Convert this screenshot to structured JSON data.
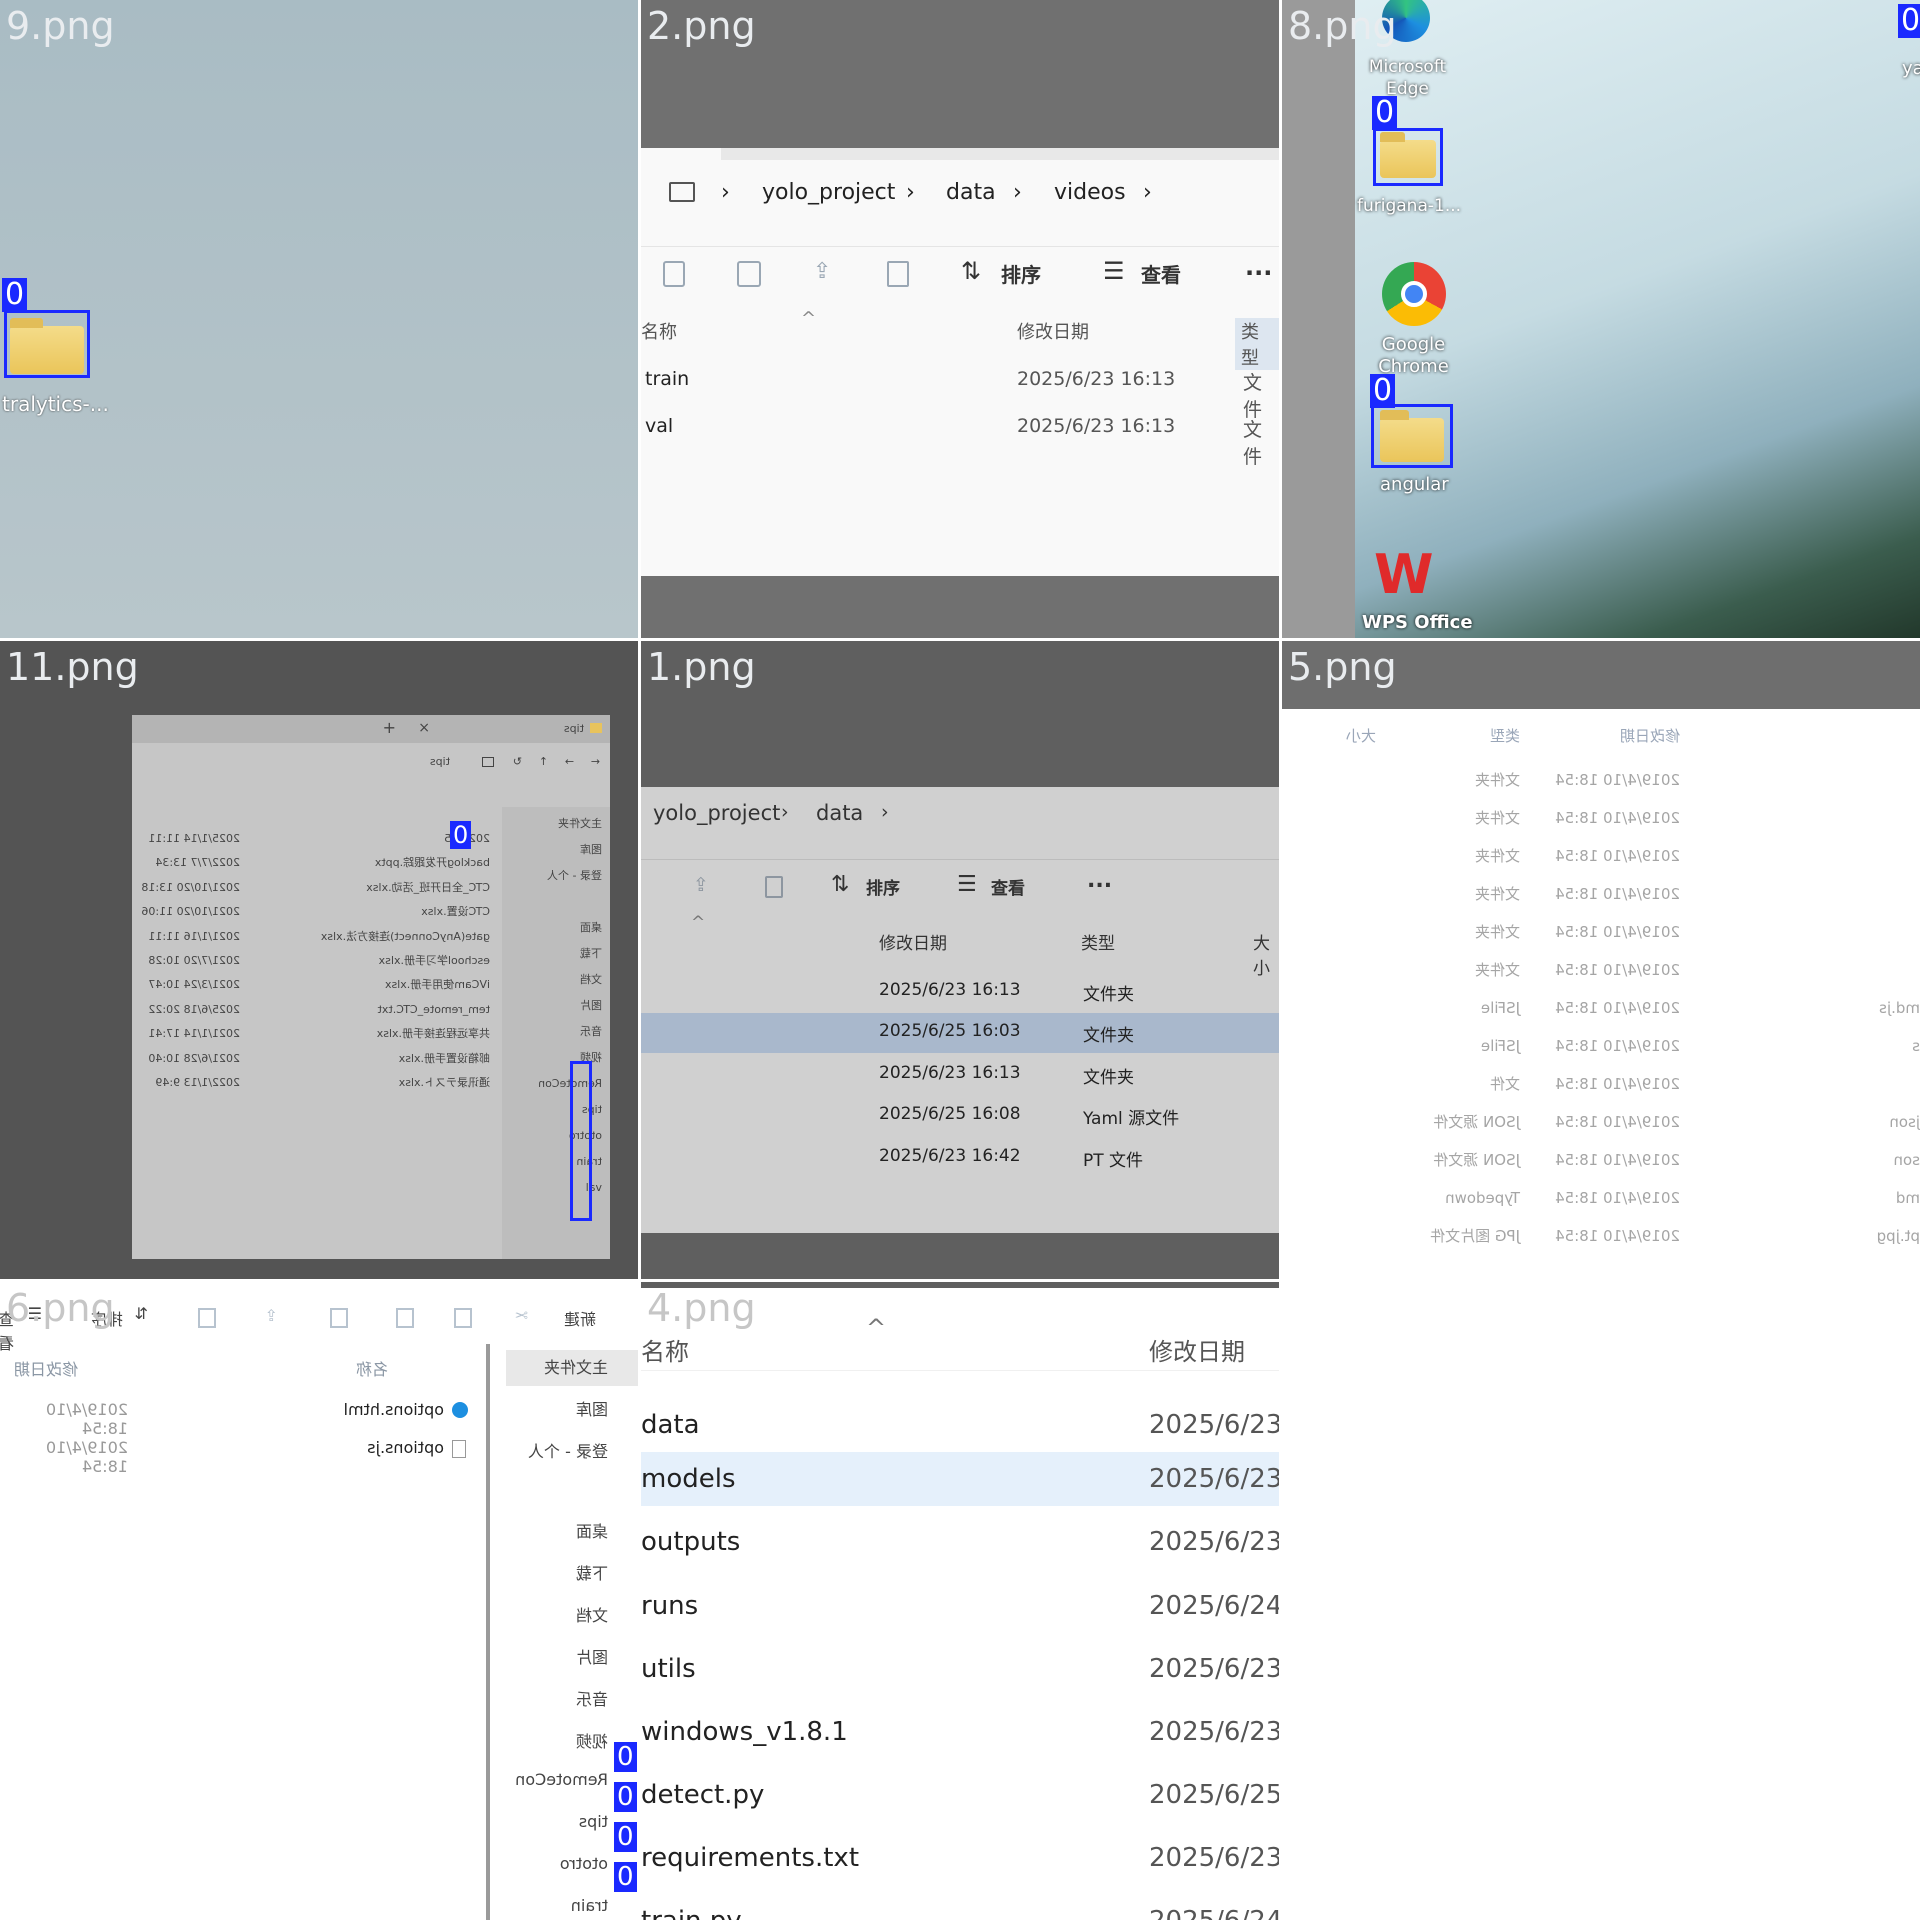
{
  "tiles": {
    "t9": {
      "label": "9.png",
      "folder_name": "tralytics-..."
    },
    "t2": {
      "label": "2.png",
      "breadcrumb": [
        "yolo_project",
        "data",
        "videos"
      ],
      "toolbar": {
        "sort": "排序",
        "view": "查看",
        "more": "..."
      },
      "columns": {
        "name": "名称",
        "modified": "修改日期",
        "type": "类型"
      },
      "rows": [
        {
          "name": "train",
          "modified": "2025/6/23 16:13",
          "type": "文件"
        },
        {
          "name": "val",
          "modified": "2025/6/23 16:13",
          "type": "文件"
        }
      ]
    },
    "t8": {
      "label": "8.png",
      "icons": {
        "edge": "Microsoft Edge",
        "furigana": "furigana-1...",
        "chrome": "Google Chrome",
        "angular": "angular",
        "wps": "WPS Office"
      },
      "right_edge_text": "ya",
      "tag": "0"
    },
    "t11": {
      "label": "11.png",
      "title": "tips",
      "rows": [
        {
          "name": "2022-05",
          "date": "2025/1/14 11:11"
        },
        {
          "name": "backlog开发跟踪.pptx",
          "date": "2022/7/7 13:34"
        },
        {
          "name": "CTC_全日开班_活动.xlsx",
          "date": "2021/10/20 13:18"
        },
        {
          "name": "CTC设置.xlsx",
          "date": "2021/10/20 11:06"
        },
        {
          "name": "gate(AnyConnect)连接方法.xlsx",
          "date": "2021/1/16 11:11"
        },
        {
          "name": "eschool学习手册.xlsx",
          "date": "2021/7/20 10:28"
        },
        {
          "name": "iVCam使用手册.xlsx",
          "date": "2021/3/24 10:47"
        },
        {
          "name": "tem_remote_CTC.txt",
          "date": "2025/6/18 20:22"
        },
        {
          "name": "共享远程连接手册.xlsx",
          "date": "2021/1/14 17:41"
        },
        {
          "name": "邮箱设置手册.xlsx",
          "date": "2021/6/28 10:40"
        },
        {
          "name": "通讯录テスト.xlsx",
          "date": "2022/1/13 9:49"
        }
      ],
      "sidebar": [
        "主文件夹",
        "图库",
        "登录 - 个人",
        "桌面",
        "下载",
        "文档",
        "图片",
        "音乐",
        "视频",
        "RemoteCon",
        "tips",
        "ototro",
        "train",
        "val"
      ]
    },
    "t1": {
      "label": "1.png",
      "breadcrumb": [
        "yolo_project",
        "data"
      ],
      "toolbar": {
        "sort": "排序",
        "view": "查看",
        "more": "..."
      },
      "columns": {
        "modified": "修改日期",
        "type": "类型",
        "size": "大小"
      },
      "rows": [
        {
          "modified": "2025/6/23 16:13",
          "type": "文件夹"
        },
        {
          "modified": "2025/6/25 16:03",
          "type": "文件夹"
        },
        {
          "modified": "2025/6/23 16:13",
          "type": "文件夹"
        },
        {
          "modified": "2025/6/25 16:08",
          "type": "Yaml 源文件"
        },
        {
          "modified": "2025/6/23 16:42",
          "type": "PT 文件"
        }
      ]
    },
    "t5": {
      "label": "5.png",
      "columns": {
        "size": "大小",
        "type": "类型",
        "modified": "修改日期"
      },
      "rows": [
        {
          "modified": "2019/4/10 18:54",
          "type": "文件夹",
          "name": ""
        },
        {
          "modified": "2019/4/10 18:54",
          "type": "文件夹",
          "name": ""
        },
        {
          "modified": "2019/4/10 18:54",
          "type": "文件夹",
          "name": ""
        },
        {
          "modified": "2019/4/10 18:54",
          "type": "文件夹",
          "name": ""
        },
        {
          "modified": "2019/4/10 18:54",
          "type": "文件夹",
          "name": ""
        },
        {
          "modified": "2019/4/10 18:54",
          "type": "文件夹",
          "name": ""
        },
        {
          "modified": "2019/4/10 18:54",
          "type": "JSFile",
          "name": "md.js"
        },
        {
          "modified": "2019/4/10 18:54",
          "type": "JSFile",
          "name": "s"
        },
        {
          "modified": "2019/4/10 18:54",
          "type": "文件",
          "name": ""
        },
        {
          "modified": "2019/4/10 18:54",
          "type": "JSON 源文件",
          "name": "json"
        },
        {
          "modified": "2019/4/10 18:54",
          "type": "JSON 源文件",
          "name": "son"
        },
        {
          "modified": "2019/4/10 18:54",
          "type": "Typedown",
          "name": "md"
        },
        {
          "modified": "2019/4/10 18:54",
          "type": "JPG 图片文件",
          "name": "pt.jpg"
        }
      ]
    },
    "t6": {
      "label": "6.png",
      "toolbar": {
        "new": "新建",
        "sort": "排序",
        "view": "查看"
      },
      "columns": {
        "name": "名称",
        "modified": "修改日期"
      },
      "rows": [
        {
          "name": "options.html",
          "date": "2019/4/10 18:54"
        },
        {
          "name": "options.js",
          "date": "2019/4/10 18:54"
        }
      ],
      "sidebar": [
        "主文件夹",
        "图库",
        "登录 - 个人",
        "桌面",
        "下载",
        "文档",
        "图片",
        "音乐",
        "视频",
        "RemoteCon",
        "tips",
        "ototro",
        "train"
      ]
    },
    "t4": {
      "label": "4.png",
      "columns": {
        "name": "名称",
        "modified": "修改日期"
      },
      "rows": [
        {
          "name": "data",
          "date": "2025/6/23"
        },
        {
          "name": "models",
          "date": "2025/6/23"
        },
        {
          "name": "outputs",
          "date": "2025/6/23"
        },
        {
          "name": "runs",
          "date": "2025/6/24"
        },
        {
          "name": "utils",
          "date": "2025/6/23"
        },
        {
          "name": "windows_v1.8.1",
          "date": "2025/6/23"
        },
        {
          "name": "detect.py",
          "date": "2025/6/25"
        },
        {
          "name": "requirements.txt",
          "date": "2025/6/23"
        },
        {
          "name": "train.py",
          "date": "2025/6/24"
        }
      ]
    }
  },
  "tag_text": "0"
}
